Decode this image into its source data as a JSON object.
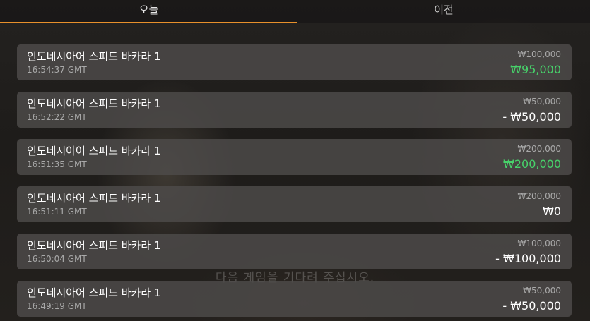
{
  "tabs": {
    "today_label": "오늘",
    "past_label": "이전"
  },
  "background": {
    "overlay_message": "다음 게임을 기다려 주십시오."
  },
  "history": [
    {
      "game": "인도네시아어 스피드 바카라 1",
      "time": "16:54:37 GMT",
      "bet": "₩100,000",
      "result": "₩95,000",
      "status": "win"
    },
    {
      "game": "인도네시아어 스피드 바카라 1",
      "time": "16:52:22 GMT",
      "bet": "₩50,000",
      "result": "- ₩50,000",
      "status": "loss"
    },
    {
      "game": "인도네시아어 스피드 바카라 1",
      "time": "16:51:35 GMT",
      "bet": "₩200,000",
      "result": "₩200,000",
      "status": "win"
    },
    {
      "game": "인도네시아어 스피드 바카라 1",
      "time": "16:51:11 GMT",
      "bet": "₩200,000",
      "result": "₩0",
      "status": "neutral"
    },
    {
      "game": "인도네시아어 스피드 바카라 1",
      "time": "16:50:04 GMT",
      "bet": "₩100,000",
      "result": "- ₩100,000",
      "status": "loss"
    },
    {
      "game": "인도네시아어 스피드 바카라 1",
      "time": "16:49:19 GMT",
      "bet": "₩50,000",
      "result": "- ₩50,000",
      "status": "loss"
    }
  ],
  "colors": {
    "accent": "#e8902b",
    "win": "#47d26a",
    "card_bg": "#4e4c4a",
    "muted_text": "#a9a9a9"
  }
}
